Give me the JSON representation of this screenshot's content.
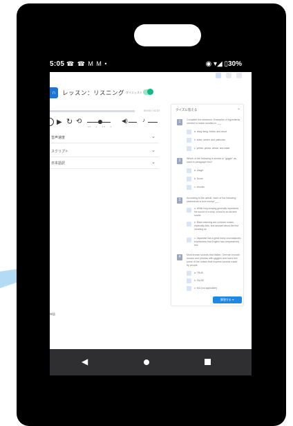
{
  "status_bar": {
    "time": "5:05",
    "notifications": "☎ ☎ M M •",
    "right": "◉ ▾◢ ▯30%"
  },
  "lesson": {
    "title": "レッスン：リスニング",
    "toggle_label": "ダイジェスト"
  },
  "player": {
    "time_readout": "00:00 / 01:37",
    "speed_ticks": [
      "0.5",
      "1",
      "1.5",
      "2"
    ]
  },
  "dropdowns": [
    {
      "label": "音声速度"
    },
    {
      "label": "スクリプト"
    },
    {
      "label": "日本語訳"
    }
  ],
  "bottom_label": "単語",
  "quiz": {
    "title": "クイズに答える",
    "questions": [
      {
        "number": "1",
        "text": "Complete the sentence: Examples of ingredients needed to make noodles is ___.",
        "options": [
          "a. dong dang, bricks, and wood",
          "b. soba, ramen, and yakisoba",
          "c. yellow, yellow, wheat, and water"
        ]
      },
      {
        "number": "2",
        "text": "Which of the following is similar to \"giggle\" as used in paragraph two?",
        "options": [
          "a. Laugh",
          "b. Snore",
          "c. chuckle"
        ]
      },
      {
        "number": "3",
        "text": "According to the article, each of the following statements is true except ___.",
        "options": [
          "a. While long slurping generally represents the sound of a slurp, a bowl is an ancient sound.",
          "b. Black watching are common noises, especially kids, and amused about the first meaning ok.",
          "c. Japanese has a great many onomatopoeic expressions that English has comparatively few."
        ]
      },
      {
        "number": "4",
        "text": "Most known sounds that Italian, German include mouse and phonics with giggles and scent are some of the noises that express sounds made by people.",
        "options": [
          "a. TRUE",
          "b. FALSE",
          "c. N/A (not applicable)"
        ]
      }
    ],
    "submit_label": "解答する ➔"
  },
  "colors": {
    "accent": "#1e88e5",
    "toggle_on": "#14b883",
    "badge": "#9aa9bd",
    "option_box": "#d6e6f7",
    "callout": "#b3dcf4"
  },
  "icons": {
    "app": "headphones-icon",
    "replay": "replay-icon",
    "play": "play-icon",
    "forward": "forward-icon",
    "loop": "loop-icon",
    "volume": "volume-icon",
    "mic": "mic-icon",
    "back": "back-icon",
    "home": "home-icon",
    "recent": "recent-apps-icon"
  }
}
